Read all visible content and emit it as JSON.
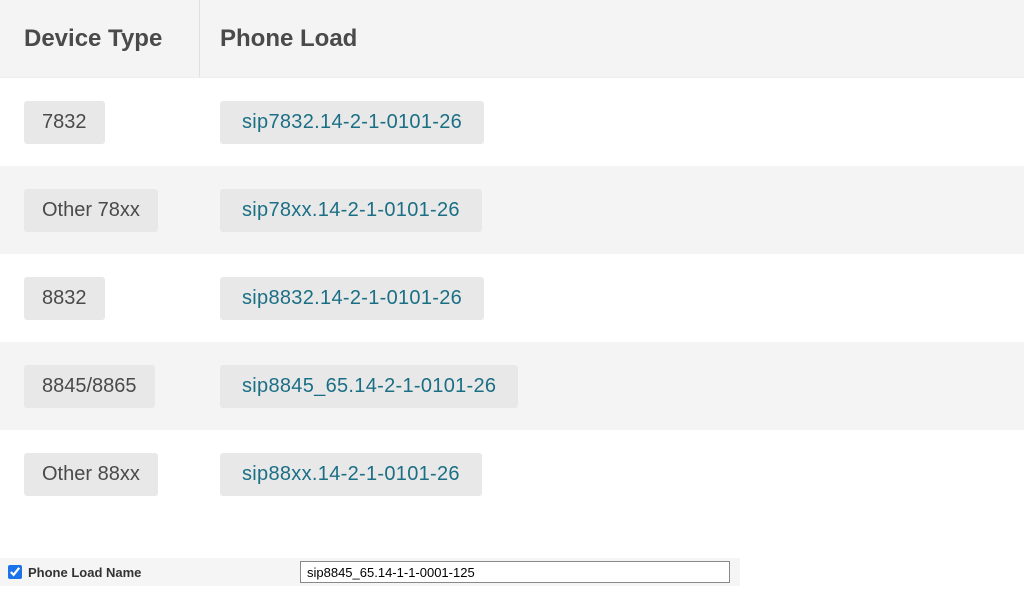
{
  "headers": {
    "device_type": "Device Type",
    "phone_load": "Phone Load"
  },
  "rows": [
    {
      "device": "7832",
      "load": "sip7832.14-2-1-0101-26"
    },
    {
      "device": "Other 78xx",
      "load": "sip78xx.14-2-1-0101-26"
    },
    {
      "device": "8832",
      "load": "sip8832.14-2-1-0101-26"
    },
    {
      "device": "8845/8865",
      "load": "sip8845_65.14-2-1-0101-26"
    },
    {
      "device": "Other 88xx",
      "load": "sip88xx.14-2-1-0101-26"
    }
  ],
  "form": {
    "checkbox_checked": true,
    "label": "Phone Load Name",
    "value": "sip8845_65.14-1-1-0001-125"
  }
}
